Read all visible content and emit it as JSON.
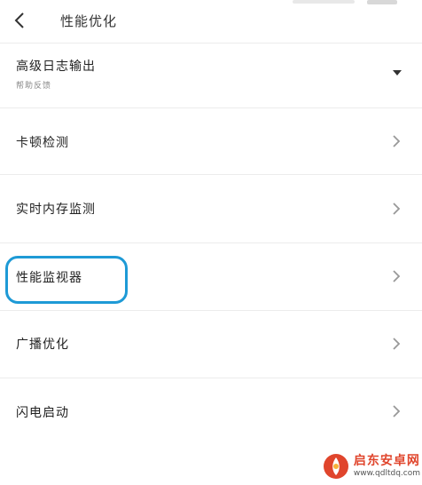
{
  "header": {
    "title": "性能优化"
  },
  "items": [
    {
      "label": "高级日志输出",
      "sub": "帮助反馈"
    },
    {
      "label": "卡顿检测"
    },
    {
      "label": "实时内存监测"
    },
    {
      "label": "性能监视器"
    },
    {
      "label": "广播优化"
    },
    {
      "label": "闪电启动"
    }
  ],
  "watermark": {
    "brand": "启东安卓网",
    "url": "www.qdltdq.com"
  },
  "colors": {
    "highlight": "#1e9ad6",
    "watermark": "#e0452c"
  }
}
